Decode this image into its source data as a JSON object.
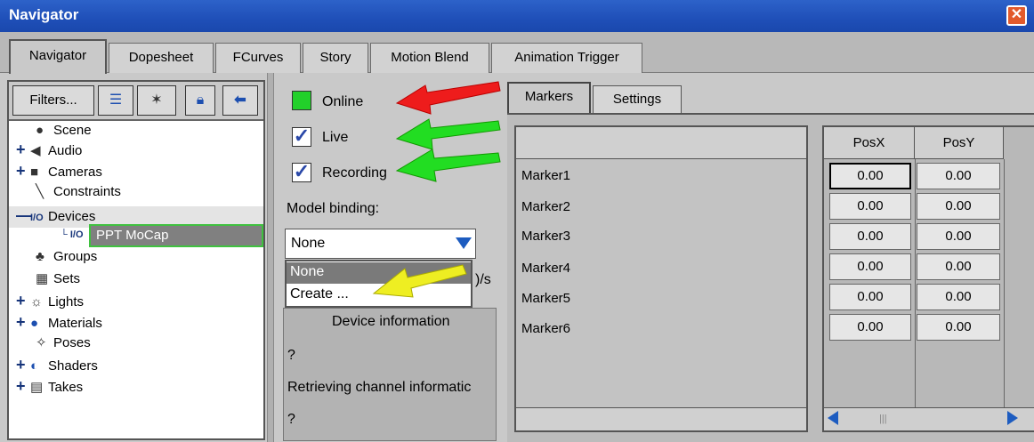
{
  "window": {
    "title": "Navigator",
    "close_icon": "close-icon"
  },
  "tabs": [
    {
      "label": "Navigator",
      "active": true
    },
    {
      "label": "Dopesheet"
    },
    {
      "label": "FCurves"
    },
    {
      "label": "Story"
    },
    {
      "label": "Motion Blend"
    },
    {
      "label": "Animation Trigger"
    }
  ],
  "toolbar": {
    "filters_label": "Filters..."
  },
  "tree": [
    {
      "label": "Scene",
      "icon": "scene-icon",
      "expandable": false
    },
    {
      "label": "Audio",
      "icon": "audio-icon",
      "expandable": true
    },
    {
      "label": "Cameras",
      "icon": "camera-icon",
      "expandable": true
    },
    {
      "label": "Constraints",
      "icon": "constraint-icon",
      "expandable": false
    },
    {
      "label": "Devices",
      "icon": "io-icon",
      "expandable": true,
      "expanded": true
    },
    {
      "label": "PPT MoCap",
      "icon": "io-icon",
      "selected": true
    },
    {
      "label": "Groups",
      "icon": "groups-icon"
    },
    {
      "label": "Sets",
      "icon": "sets-icon"
    },
    {
      "label": "Lights",
      "icon": "light-icon",
      "expandable": true
    },
    {
      "label": "Materials",
      "icon": "material-icon",
      "expandable": true
    },
    {
      "label": "Poses",
      "icon": "pose-icon"
    },
    {
      "label": "Shaders",
      "icon": "shader-icon",
      "expandable": true
    },
    {
      "label": "Takes",
      "icon": "takes-icon",
      "expandable": true
    }
  ],
  "device": {
    "online_label": "Online",
    "online_color": "#22d02a",
    "live_label": "Live",
    "recording_label": "Recording",
    "model_binding_label": "Model binding:",
    "binding_value": "None",
    "binding_options": [
      "None",
      "Create ..."
    ],
    "rate_fragment": ")/s",
    "info_title": "Device information",
    "info_line1": "?",
    "info_line2": "Retrieving channel informatic",
    "info_line3": "?"
  },
  "subtabs": [
    {
      "label": "Markers",
      "active": true
    },
    {
      "label": "Settings"
    }
  ],
  "markers": {
    "columns": [
      "PosX",
      "PosY"
    ],
    "rows": [
      {
        "name": "Marker1",
        "posx": "0.00",
        "posy": "0.00"
      },
      {
        "name": "Marker2",
        "posx": "0.00",
        "posy": "0.00"
      },
      {
        "name": "Marker3",
        "posx": "0.00",
        "posy": "0.00"
      },
      {
        "name": "Marker4",
        "posx": "0.00",
        "posy": "0.00"
      },
      {
        "name": "Marker5",
        "posx": "0.00",
        "posy": "0.00"
      },
      {
        "name": "Marker6",
        "posx": "0.00",
        "posy": "0.00"
      }
    ]
  },
  "annotations": {
    "arrow_colors": [
      "#ee1c1c",
      "#22dd22",
      "#22dd22",
      "#eeee22"
    ]
  }
}
